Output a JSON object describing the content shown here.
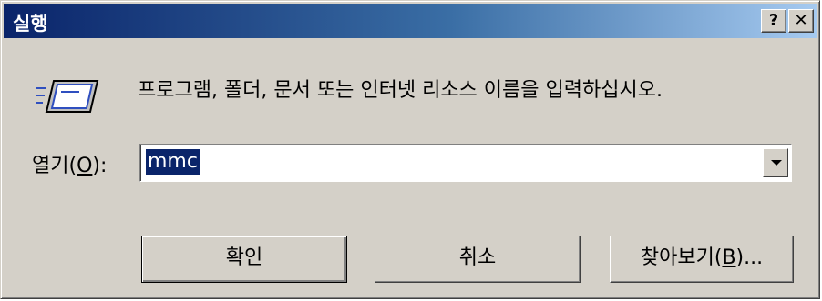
{
  "window": {
    "title": "실행",
    "help_label": "?",
    "close_label": "✕"
  },
  "icon": {
    "name": "run-icon"
  },
  "prompt_text": "프로그램, 폴더, 문서 또는 인터넷 리소스 이름을 입력하십시오.",
  "open_field": {
    "label_prefix": "열기(",
    "label_accel": "O",
    "label_suffix": "):",
    "value": "mmc"
  },
  "buttons": {
    "ok": "확인",
    "cancel": "취소",
    "browse_prefix": "찾아보기(",
    "browse_accel": "B",
    "browse_suffix": ")..."
  },
  "colors": {
    "title_start": "#0a246a",
    "title_end": "#a6caf0",
    "face": "#d4d0c8",
    "selection": "#0a246a"
  }
}
